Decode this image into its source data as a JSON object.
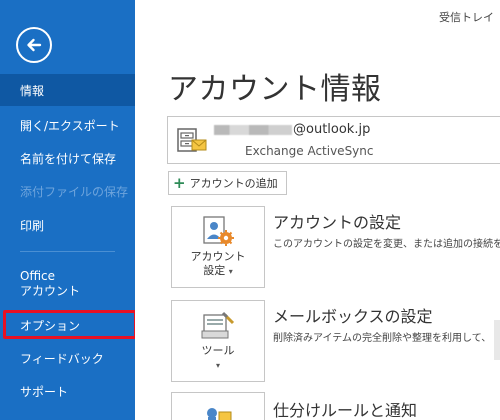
{
  "header": {
    "right_title": "受信トレイ"
  },
  "sidebar": {
    "back_icon": "back-arrow-icon",
    "items": [
      {
        "label": "情報"
      },
      {
        "label": "開く/エクスポート"
      },
      {
        "label": "名前を付けて保存"
      },
      {
        "label": "添付ファイルの保存"
      },
      {
        "label": "印刷"
      },
      {
        "label": "Office"
      },
      {
        "label": "アカウント"
      },
      {
        "label": "オプション"
      },
      {
        "label": "フィードバック"
      },
      {
        "label": "サポート"
      }
    ]
  },
  "main": {
    "title": "アカウント情報",
    "account": {
      "email_suffix": "@outlook.jp",
      "type": "Exchange ActiveSync"
    },
    "add_account_label": "アカウントの追加",
    "sections": [
      {
        "tile_line1": "アカウント",
        "tile_line2": "設定",
        "title": "アカウントの設定",
        "desc": "このアカウントの設定を変更、または追加の接続を"
      },
      {
        "tile_line1": "ツール",
        "title": "メールボックスの設定",
        "desc": "削除済みアイテムの完全削除や整理を利用して、"
      },
      {
        "title": "仕分けルールと通知"
      }
    ]
  },
  "colors": {
    "sidebar": "#1a6fc4",
    "sidebar_active": "#0f58a3",
    "highlight": "#e81123"
  }
}
